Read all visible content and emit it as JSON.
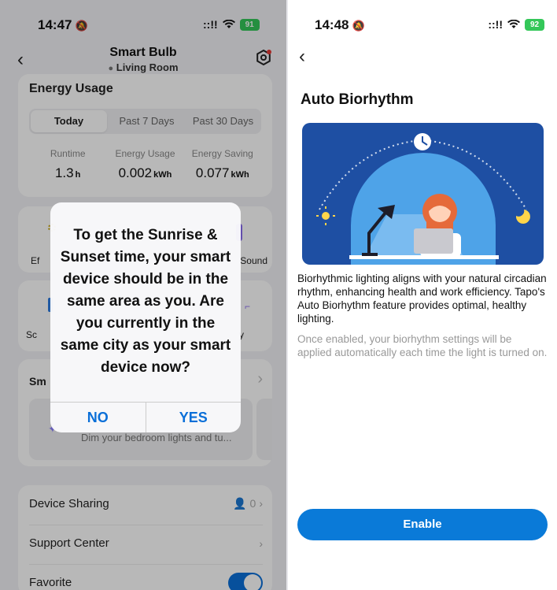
{
  "left": {
    "status": {
      "time": "14:47",
      "signal": "::!!",
      "battery": "91"
    },
    "header": {
      "title": "Smart Bulb",
      "location": "Living Room"
    },
    "energy": {
      "title": "Energy Usage",
      "tabs": [
        "Today",
        "Past 7 Days",
        "Past 30 Days"
      ],
      "stats": [
        {
          "label": "Runtime",
          "value": "1.3",
          "unit": "h"
        },
        {
          "label": "Energy Usage",
          "value": "0.002",
          "unit": "kWh"
        },
        {
          "label": "Energy Saving",
          "value": "0.077",
          "unit": "kWh"
        }
      ]
    },
    "features_row1": {
      "left": "Ef",
      "right": "Sound"
    },
    "features_row2": {
      "left": "Sc",
      "right": "y"
    },
    "smart": {
      "label": "Sm",
      "desc": "Dim your bedroom lights and tu..."
    },
    "list": {
      "sharing": "Device Sharing",
      "sharing_count": "0",
      "support": "Support Center",
      "favorite": "Favorite"
    },
    "alert": {
      "message": "To get the Sunrise & Sunset time, your smart device should be in the same area as you. Are you currently in the same city as your smart device now?",
      "no": "NO",
      "yes": "YES"
    }
  },
  "right": {
    "status": {
      "time": "14:48",
      "signal": "::!!",
      "battery": "92"
    },
    "title": "Auto Biorhythm",
    "description": "Biorhythmic lighting aligns with your natural circadian rhythm, enhancing health and work efficiency. Tapo's Auto Biorhythm feature provides optimal, healthy lighting.",
    "note": "Once enabled, your biorhythm settings will be applied automatically each time the light is turned on.",
    "enable": "Enable"
  },
  "icons": [
    "bell-slash-icon",
    "wifi-icon",
    "location-pin-icon",
    "settings-hex-icon",
    "chevron-left-icon",
    "chevron-right-icon",
    "person-icon",
    "sparkle-icon",
    "clock-icon",
    "sun-icon",
    "moon-icon"
  ],
  "colors": {
    "accent": "#0a7ad8",
    "battery": "#34c759",
    "illustration_bg": "#1e4fa3"
  }
}
